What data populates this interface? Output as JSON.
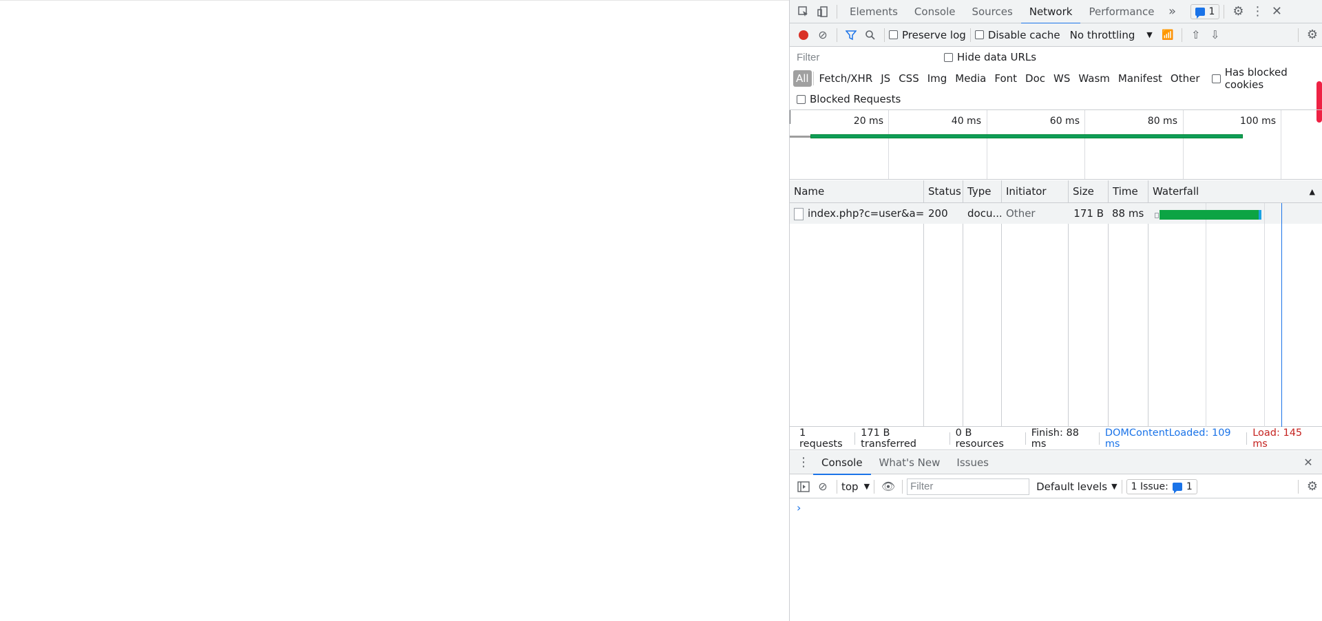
{
  "devtools": {
    "tabs": [
      {
        "label": "Elements",
        "active": false
      },
      {
        "label": "Console",
        "active": false
      },
      {
        "label": "Sources",
        "active": false
      },
      {
        "label": "Network",
        "active": true
      },
      {
        "label": "Performance",
        "active": false
      }
    ],
    "issues_count": "1"
  },
  "toolbar": {
    "preserve_log": "Preserve log",
    "disable_cache": "Disable cache",
    "throttling": "No throttling"
  },
  "filter": {
    "placeholder": "Filter",
    "hide_data_urls": "Hide data URLs",
    "types": [
      "All",
      "Fetch/XHR",
      "JS",
      "CSS",
      "Img",
      "Media",
      "Font",
      "Doc",
      "WS",
      "Wasm",
      "Manifest",
      "Other"
    ],
    "has_blocked_cookies": "Has blocked cookies",
    "blocked_requests": "Blocked Requests"
  },
  "overview": {
    "ticks": [
      "20 ms",
      "40 ms",
      "60 ms",
      "80 ms",
      "100 ms"
    ]
  },
  "table": {
    "headers": {
      "name": "Name",
      "status": "Status",
      "type": "Type",
      "initiator": "Initiator",
      "size": "Size",
      "time": "Time",
      "waterfall": "Waterfall"
    },
    "rows": [
      {
        "name": "index.php?c=user&a=...",
        "status": "200",
        "type": "docu...",
        "initiator": "Other",
        "size": "171 B",
        "time": "88 ms"
      }
    ]
  },
  "status": {
    "requests": "1 requests",
    "transferred": "171 B transferred",
    "resources": "0 B resources",
    "finish": "Finish: 88 ms",
    "dcl": "DOMContentLoaded: 109 ms",
    "load": "Load: 145 ms"
  },
  "drawer": {
    "tabs": [
      {
        "label": "Console",
        "active": true
      },
      {
        "label": "What's New",
        "active": false
      },
      {
        "label": "Issues",
        "active": false
      }
    ],
    "context": "top",
    "filter_placeholder": "Filter",
    "levels": "Default levels",
    "issue_label": "1 Issue:",
    "issue_count": "1",
    "prompt": "›"
  },
  "colors": {
    "accent": "#1a73e8",
    "record": "#d93025",
    "bar": "#0ca444",
    "load": "#c5221f"
  }
}
